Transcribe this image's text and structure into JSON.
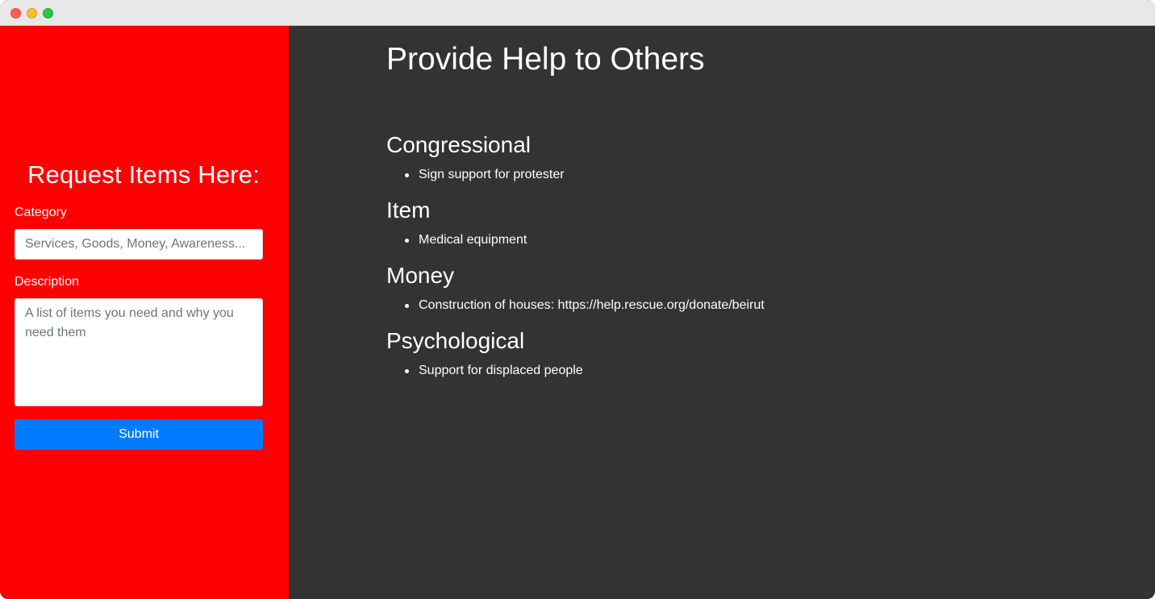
{
  "sidebar": {
    "title": "Request Items Here:",
    "category_label": "Category",
    "category_placeholder": "Services, Goods, Money, Awareness...",
    "description_label": "Description",
    "description_placeholder": "A list of items you need and why you need them",
    "submit_label": "Submit",
    "background_color": "#ff0000",
    "button_color": "#007bff"
  },
  "main": {
    "title": "Provide Help to Others",
    "background_color": "#333333",
    "sections": [
      {
        "heading": "Congressional",
        "items": [
          "Sign support for protester"
        ]
      },
      {
        "heading": "Item",
        "items": [
          "Medical equipment"
        ]
      },
      {
        "heading": "Money",
        "items": [
          "Construction of houses: https://help.rescue.org/donate/beirut"
        ]
      },
      {
        "heading": "Psychological",
        "items": [
          "Support for displaced people"
        ]
      }
    ]
  }
}
